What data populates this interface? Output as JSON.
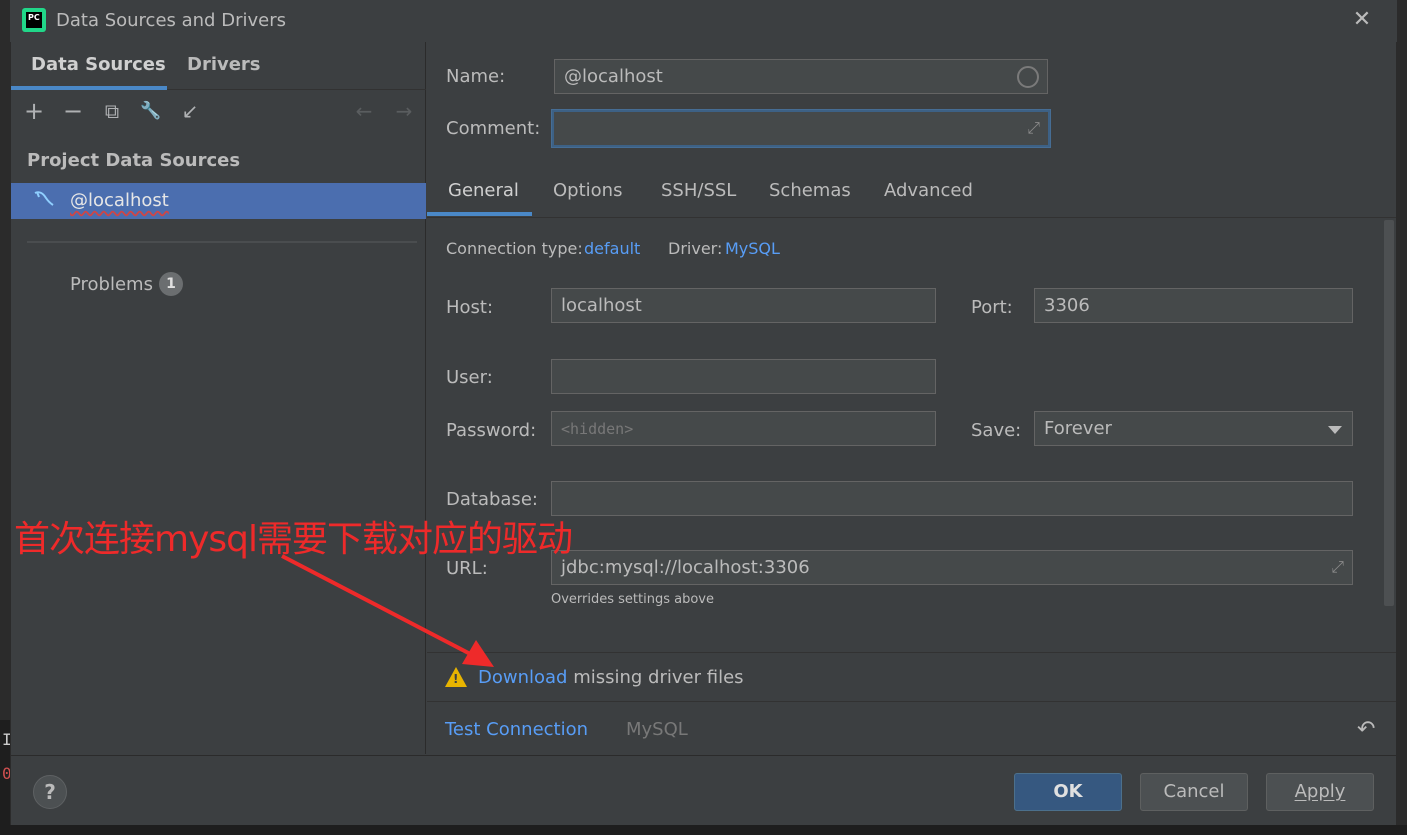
{
  "window": {
    "title": "Data Sources and Drivers",
    "app_icon_text": "PC"
  },
  "left_tabs": [
    {
      "label": "Data Sources"
    },
    {
      "label": "Drivers"
    }
  ],
  "toolbar": {
    "add": "+",
    "remove": "−",
    "copy": "⧉",
    "settings": "🔧",
    "import": "↙",
    "back": "←",
    "forward": "→"
  },
  "sidebar": {
    "section": "Project Data Sources",
    "items": [
      {
        "label": "@localhost"
      }
    ],
    "problems_label": "Problems",
    "problems_count": "1"
  },
  "form": {
    "name_label": "Name:",
    "name_value": "@localhost",
    "comment_label": "Comment:",
    "comment_value": ""
  },
  "tabs": [
    {
      "label": "General"
    },
    {
      "label": "Options"
    },
    {
      "label": "SSH/SSL"
    },
    {
      "label": "Schemas"
    },
    {
      "label": "Advanced"
    }
  ],
  "general": {
    "connection_type_label": "Connection type:",
    "connection_type_value": "default",
    "driver_label": "Driver:",
    "driver_value": "MySQL",
    "host_label": "Host:",
    "host_value": "localhost",
    "port_label": "Port:",
    "port_value": "3306",
    "user_label": "User:",
    "user_value": "",
    "password_label": "Password:",
    "password_placeholder": "<hidden>",
    "save_label": "Save:",
    "save_value": "Forever",
    "database_label": "Database:",
    "database_value": "",
    "url_label": "URL:",
    "url_value": "jdbc:mysql://localhost:3306",
    "url_note": "Overrides settings above"
  },
  "warning": {
    "link": "Download",
    "text": " missing driver files"
  },
  "test": {
    "link": "Test Connection",
    "driver": "MySQL"
  },
  "buttons": {
    "help": "?",
    "ok": "OK",
    "cancel": "Cancel",
    "apply": "Apply"
  },
  "annotation": {
    "text": "首次连接mysql需要下载对应的驱动"
  },
  "colors": {
    "accent": "#589df6",
    "selection": "#4b6eaf",
    "annotation": "#ee2a2a",
    "warning": "#e8b400"
  }
}
